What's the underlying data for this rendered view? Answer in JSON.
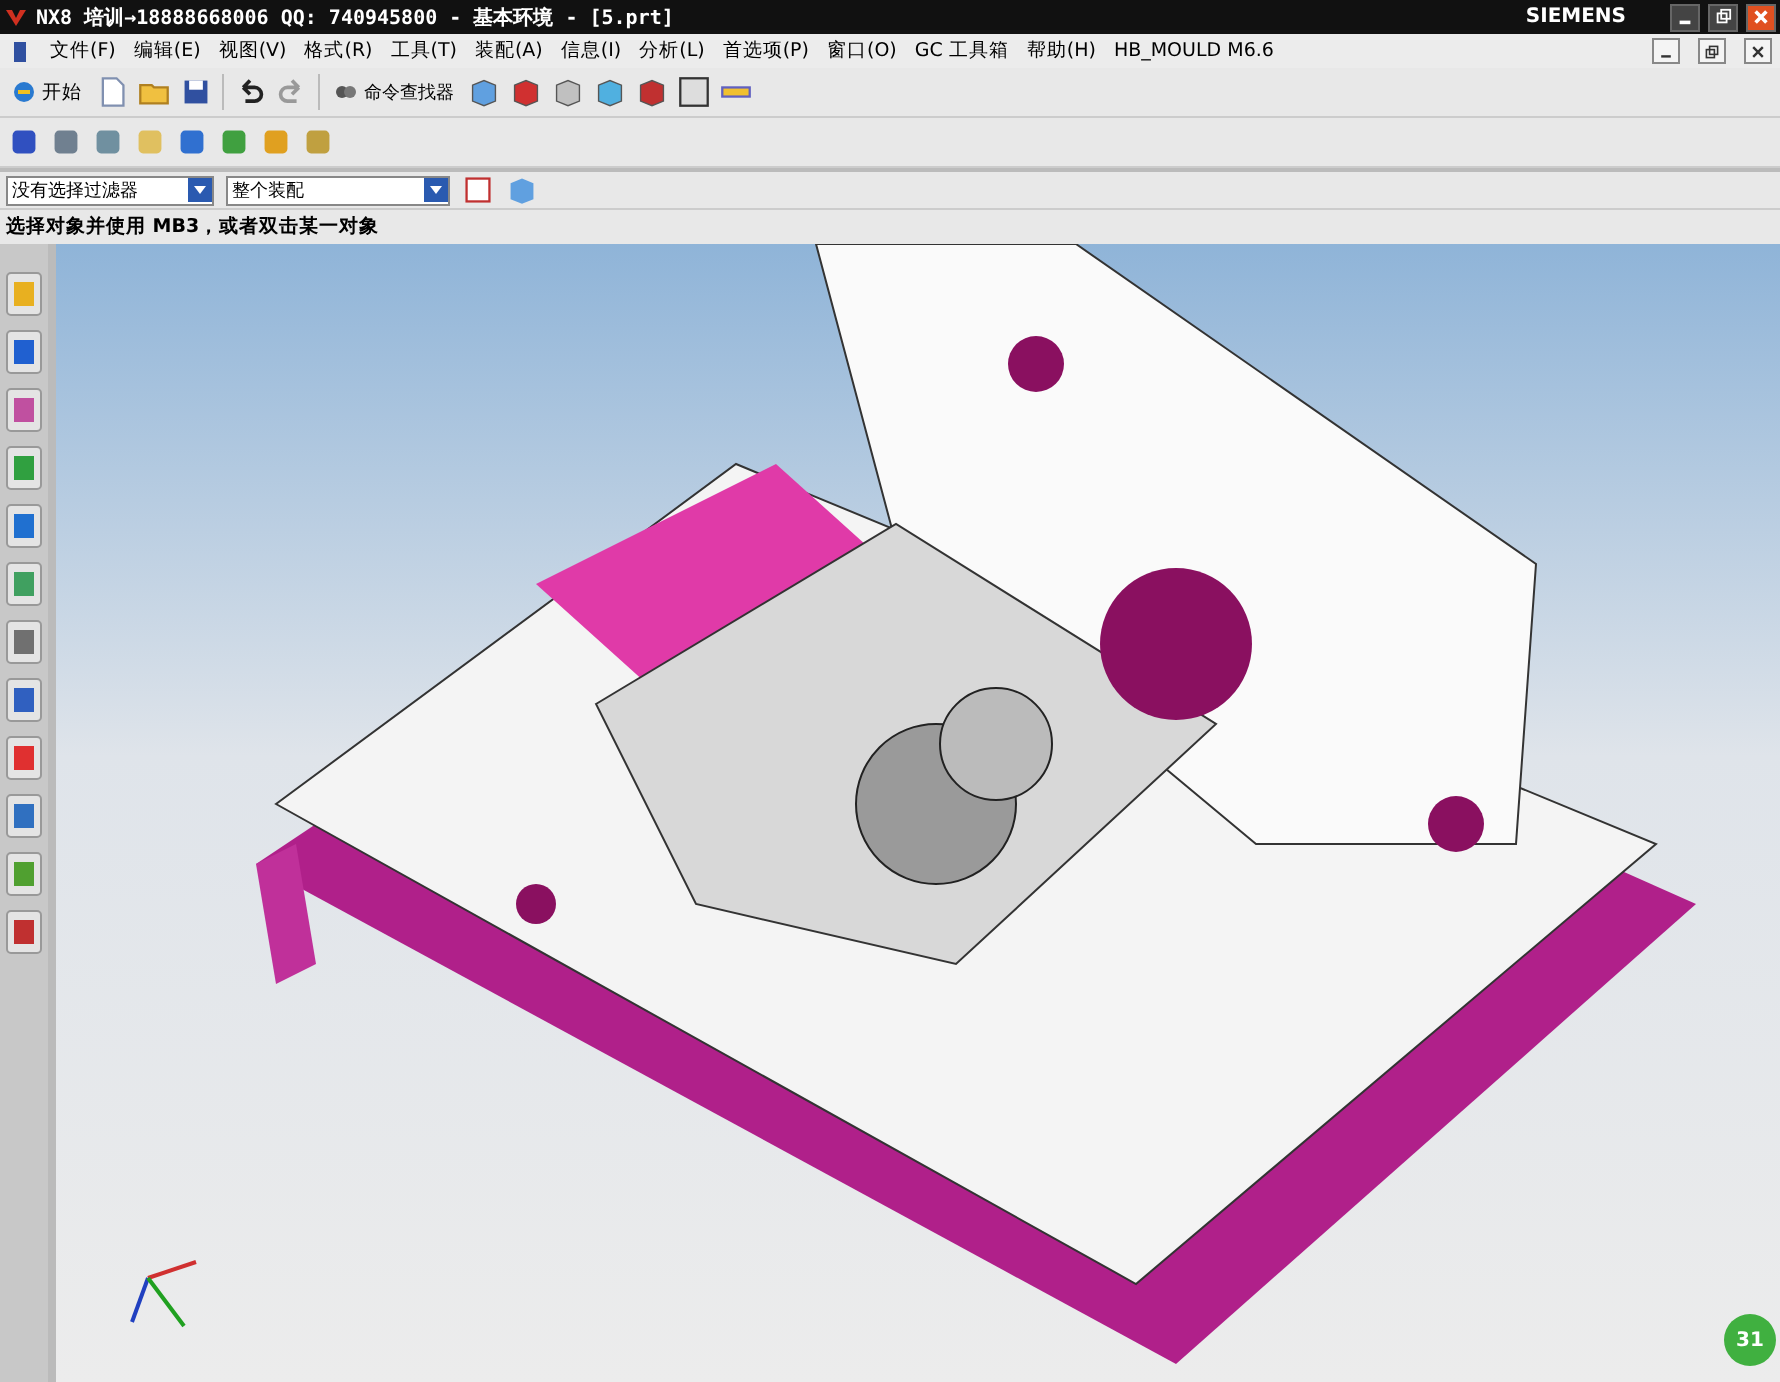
{
  "window": {
    "title": "NX8 培训→18888668006 QQ: 740945800 - 基本环境 - [5.prt]",
    "brand": "SIEMENS"
  },
  "menu": [
    "文件(F)",
    "编辑(E)",
    "视图(V)",
    "格式(R)",
    "工具(T)",
    "装配(A)",
    "信息(I)",
    "分析(L)",
    "首选项(P)",
    "窗口(O)",
    "GC 工具箱",
    "帮助(H)",
    "HB_MOULD M6.6"
  ],
  "toolbar": {
    "start": "开始",
    "command_finder": "命令查找器"
  },
  "filters": [
    {
      "value": "没有选择过滤器"
    },
    {
      "value": "整个装配"
    }
  ],
  "status_bar": "选择对象并使用 MB3，或者双击某一对象",
  "badge": "31"
}
